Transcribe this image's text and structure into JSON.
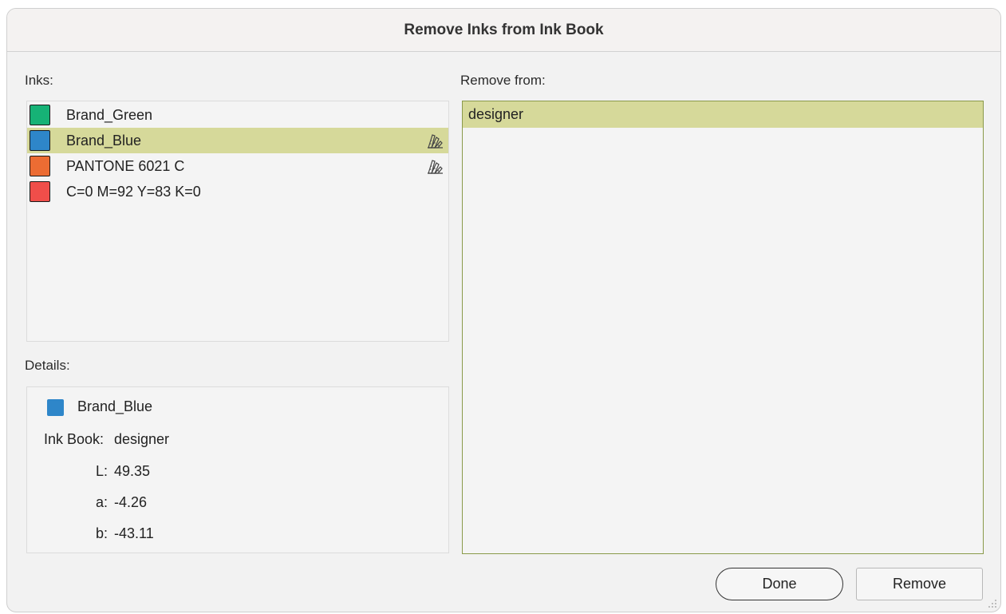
{
  "dialog": {
    "title": "Remove Inks from Ink Book",
    "inks_label": "Inks:",
    "remove_from_label": "Remove from:",
    "details_label": "Details:"
  },
  "inks": [
    {
      "name": "Brand_Green",
      "color": "#16b276",
      "library_icon": false,
      "selected": false
    },
    {
      "name": "Brand_Blue",
      "color": "#2e86c9",
      "library_icon": true,
      "selected": true
    },
    {
      "name": "PANTONE 6021 C",
      "color": "#ec6c33",
      "library_icon": true,
      "selected": false
    },
    {
      "name": "C=0 M=92 Y=83 K=0",
      "color": "#f04e4a",
      "library_icon": false,
      "selected": false
    }
  ],
  "remove_from": [
    {
      "name": "designer",
      "selected": true
    }
  ],
  "details": {
    "name": "Brand_Blue",
    "color": "#2e86c9",
    "ink_book_label": "Ink Book:",
    "ink_book_value": "designer",
    "l_label": "L:",
    "l_value": "49.35",
    "a_label": "a:",
    "a_value": "-4.26",
    "b_label": "b:",
    "b_value": "-43.11"
  },
  "buttons": {
    "done": "Done",
    "remove": "Remove"
  },
  "colors": {
    "selection": "#d6d99a",
    "remove_list_border": "#8a9a4a"
  },
  "icons": {
    "library": "color-library-icon",
    "resize": "resize-grip-icon"
  }
}
